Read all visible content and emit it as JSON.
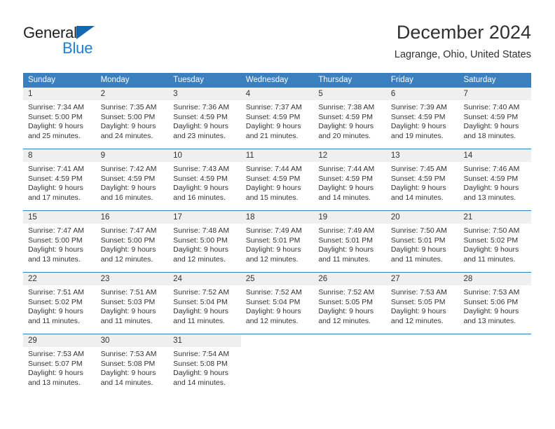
{
  "logo": {
    "word_top": "General",
    "word_bottom": "Blue",
    "triangle_color": "#1667b2",
    "blue_color": "#1c7fd4"
  },
  "header": {
    "title": "December 2024",
    "subtitle": "Lagrange, Ohio, United States"
  },
  "theme": {
    "header_bg": "#3c7fbf",
    "day_band_bg": "#efefef",
    "text": "#333333"
  },
  "weekdays": [
    "Sunday",
    "Monday",
    "Tuesday",
    "Wednesday",
    "Thursday",
    "Friday",
    "Saturday"
  ],
  "weeks": [
    [
      {
        "day": "1",
        "l1": "Sunrise: 7:34 AM",
        "l2": "Sunset: 5:00 PM",
        "l3": "Daylight: 9 hours",
        "l4": "and 25 minutes."
      },
      {
        "day": "2",
        "l1": "Sunrise: 7:35 AM",
        "l2": "Sunset: 5:00 PM",
        "l3": "Daylight: 9 hours",
        "l4": "and 24 minutes."
      },
      {
        "day": "3",
        "l1": "Sunrise: 7:36 AM",
        "l2": "Sunset: 4:59 PM",
        "l3": "Daylight: 9 hours",
        "l4": "and 23 minutes."
      },
      {
        "day": "4",
        "l1": "Sunrise: 7:37 AM",
        "l2": "Sunset: 4:59 PM",
        "l3": "Daylight: 9 hours",
        "l4": "and 21 minutes."
      },
      {
        "day": "5",
        "l1": "Sunrise: 7:38 AM",
        "l2": "Sunset: 4:59 PM",
        "l3": "Daylight: 9 hours",
        "l4": "and 20 minutes."
      },
      {
        "day": "6",
        "l1": "Sunrise: 7:39 AM",
        "l2": "Sunset: 4:59 PM",
        "l3": "Daylight: 9 hours",
        "l4": "and 19 minutes."
      },
      {
        "day": "7",
        "l1": "Sunrise: 7:40 AM",
        "l2": "Sunset: 4:59 PM",
        "l3": "Daylight: 9 hours",
        "l4": "and 18 minutes."
      }
    ],
    [
      {
        "day": "8",
        "l1": "Sunrise: 7:41 AM",
        "l2": "Sunset: 4:59 PM",
        "l3": "Daylight: 9 hours",
        "l4": "and 17 minutes."
      },
      {
        "day": "9",
        "l1": "Sunrise: 7:42 AM",
        "l2": "Sunset: 4:59 PM",
        "l3": "Daylight: 9 hours",
        "l4": "and 16 minutes."
      },
      {
        "day": "10",
        "l1": "Sunrise: 7:43 AM",
        "l2": "Sunset: 4:59 PM",
        "l3": "Daylight: 9 hours",
        "l4": "and 16 minutes."
      },
      {
        "day": "11",
        "l1": "Sunrise: 7:44 AM",
        "l2": "Sunset: 4:59 PM",
        "l3": "Daylight: 9 hours",
        "l4": "and 15 minutes."
      },
      {
        "day": "12",
        "l1": "Sunrise: 7:44 AM",
        "l2": "Sunset: 4:59 PM",
        "l3": "Daylight: 9 hours",
        "l4": "and 14 minutes."
      },
      {
        "day": "13",
        "l1": "Sunrise: 7:45 AM",
        "l2": "Sunset: 4:59 PM",
        "l3": "Daylight: 9 hours",
        "l4": "and 14 minutes."
      },
      {
        "day": "14",
        "l1": "Sunrise: 7:46 AM",
        "l2": "Sunset: 4:59 PM",
        "l3": "Daylight: 9 hours",
        "l4": "and 13 minutes."
      }
    ],
    [
      {
        "day": "15",
        "l1": "Sunrise: 7:47 AM",
        "l2": "Sunset: 5:00 PM",
        "l3": "Daylight: 9 hours",
        "l4": "and 13 minutes."
      },
      {
        "day": "16",
        "l1": "Sunrise: 7:47 AM",
        "l2": "Sunset: 5:00 PM",
        "l3": "Daylight: 9 hours",
        "l4": "and 12 minutes."
      },
      {
        "day": "17",
        "l1": "Sunrise: 7:48 AM",
        "l2": "Sunset: 5:00 PM",
        "l3": "Daylight: 9 hours",
        "l4": "and 12 minutes."
      },
      {
        "day": "18",
        "l1": "Sunrise: 7:49 AM",
        "l2": "Sunset: 5:01 PM",
        "l3": "Daylight: 9 hours",
        "l4": "and 12 minutes."
      },
      {
        "day": "19",
        "l1": "Sunrise: 7:49 AM",
        "l2": "Sunset: 5:01 PM",
        "l3": "Daylight: 9 hours",
        "l4": "and 11 minutes."
      },
      {
        "day": "20",
        "l1": "Sunrise: 7:50 AM",
        "l2": "Sunset: 5:01 PM",
        "l3": "Daylight: 9 hours",
        "l4": "and 11 minutes."
      },
      {
        "day": "21",
        "l1": "Sunrise: 7:50 AM",
        "l2": "Sunset: 5:02 PM",
        "l3": "Daylight: 9 hours",
        "l4": "and 11 minutes."
      }
    ],
    [
      {
        "day": "22",
        "l1": "Sunrise: 7:51 AM",
        "l2": "Sunset: 5:02 PM",
        "l3": "Daylight: 9 hours",
        "l4": "and 11 minutes."
      },
      {
        "day": "23",
        "l1": "Sunrise: 7:51 AM",
        "l2": "Sunset: 5:03 PM",
        "l3": "Daylight: 9 hours",
        "l4": "and 11 minutes."
      },
      {
        "day": "24",
        "l1": "Sunrise: 7:52 AM",
        "l2": "Sunset: 5:04 PM",
        "l3": "Daylight: 9 hours",
        "l4": "and 11 minutes."
      },
      {
        "day": "25",
        "l1": "Sunrise: 7:52 AM",
        "l2": "Sunset: 5:04 PM",
        "l3": "Daylight: 9 hours",
        "l4": "and 12 minutes."
      },
      {
        "day": "26",
        "l1": "Sunrise: 7:52 AM",
        "l2": "Sunset: 5:05 PM",
        "l3": "Daylight: 9 hours",
        "l4": "and 12 minutes."
      },
      {
        "day": "27",
        "l1": "Sunrise: 7:53 AM",
        "l2": "Sunset: 5:05 PM",
        "l3": "Daylight: 9 hours",
        "l4": "and 12 minutes."
      },
      {
        "day": "28",
        "l1": "Sunrise: 7:53 AM",
        "l2": "Sunset: 5:06 PM",
        "l3": "Daylight: 9 hours",
        "l4": "and 13 minutes."
      }
    ],
    [
      {
        "day": "29",
        "l1": "Sunrise: 7:53 AM",
        "l2": "Sunset: 5:07 PM",
        "l3": "Daylight: 9 hours",
        "l4": "and 13 minutes."
      },
      {
        "day": "30",
        "l1": "Sunrise: 7:53 AM",
        "l2": "Sunset: 5:08 PM",
        "l3": "Daylight: 9 hours",
        "l4": "and 14 minutes."
      },
      {
        "day": "31",
        "l1": "Sunrise: 7:54 AM",
        "l2": "Sunset: 5:08 PM",
        "l3": "Daylight: 9 hours",
        "l4": "and 14 minutes."
      },
      {
        "day": "",
        "l1": "",
        "l2": "",
        "l3": "",
        "l4": ""
      },
      {
        "day": "",
        "l1": "",
        "l2": "",
        "l3": "",
        "l4": ""
      },
      {
        "day": "",
        "l1": "",
        "l2": "",
        "l3": "",
        "l4": ""
      },
      {
        "day": "",
        "l1": "",
        "l2": "",
        "l3": "",
        "l4": ""
      }
    ]
  ]
}
